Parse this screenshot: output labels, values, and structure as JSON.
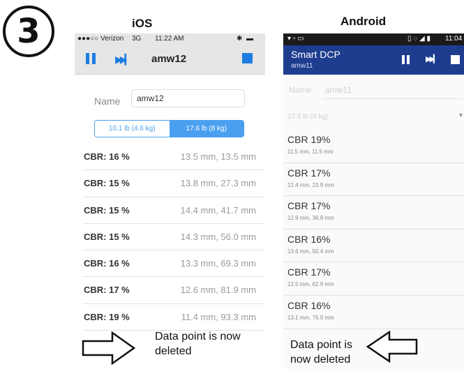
{
  "step_number": "3",
  "ios": {
    "heading": "iOS",
    "status": {
      "carrier": "●●●○○ Verizon",
      "network": "3G",
      "time": "11:22 AM",
      "bluetooth": "✱",
      "battery": "▬"
    },
    "toolbar": {
      "title": "amw12",
      "pause_icon": "pause-icon",
      "skip_icon": "skip-forward-icon",
      "stop_icon": "stop-icon"
    },
    "name_label": "Name",
    "name_value": "amw12",
    "weights": [
      "10.1 lb (4.6 kg)",
      "17.6 lb (8 kg)"
    ],
    "selected_weight": "17.6 lb (8 kg)",
    "readings": [
      {
        "cbr": "CBR: 16 %",
        "mm": "13.5 mm, 13.5 mm"
      },
      {
        "cbr": "CBR: 15 %",
        "mm": "13.8 mm, 27.3 mm"
      },
      {
        "cbr": "CBR: 15 %",
        "mm": "14.4 mm, 41.7 mm"
      },
      {
        "cbr": "CBR: 15 %",
        "mm": "14.3 mm, 56.0 mm"
      },
      {
        "cbr": "CBR: 16 %",
        "mm": "13.3 mm, 69.3 mm"
      },
      {
        "cbr": "CBR: 17 %",
        "mm": "12.6 mm, 81.9 mm"
      },
      {
        "cbr": "CBR: 19 %",
        "mm": "11.4 mm, 93.3 mm"
      }
    ],
    "note": "Data point is now deleted"
  },
  "android": {
    "heading": "Android",
    "status": {
      "left_icons": "▾ ▫ ▭",
      "right_icons": "▯ ◌ ◢ ▮",
      "time": "11:04"
    },
    "appbar": {
      "title": "Smart DCP",
      "subtitle": "amw11",
      "pause_icon": "pause-icon",
      "skip_icon": "skip-forward-icon",
      "stop_icon": "stop-icon"
    },
    "name_label": "Name",
    "name_value": "amw11",
    "weight": "17.6 lb (8 kg)",
    "readings": [
      {
        "cbr": "CBR 19%",
        "mm": "11.5 mm, 11.5 mm"
      },
      {
        "cbr": "CBR 17%",
        "mm": "12.4 mm, 23.9 mm"
      },
      {
        "cbr": "CBR 17%",
        "mm": "12.9 mm, 36.8 mm"
      },
      {
        "cbr": "CBR 16%",
        "mm": "13.6 mm, 50.4 mm"
      },
      {
        "cbr": "CBR 17%",
        "mm": "12.5 mm, 62.9 mm"
      },
      {
        "cbr": "CBR 16%",
        "mm": "13.1 mm, 76.0 mm"
      }
    ],
    "note": "Data point is now deleted"
  },
  "colors": {
    "ios_accent": "#1e7de0",
    "android_appbar": "#1e3d8f"
  }
}
